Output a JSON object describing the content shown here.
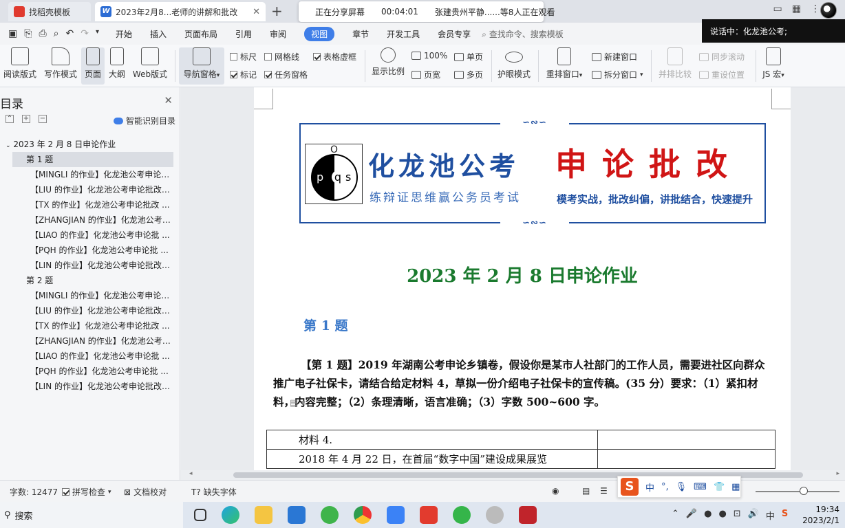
{
  "tabs": [
    {
      "label": "找稻壳模板"
    },
    {
      "label": "2023年2月8...老师的讲解和批改"
    }
  ],
  "share_bar": {
    "status": "正在分享屏幕",
    "time": "00:04:01",
    "viewers": "张建贵州平静......等8人正在观看"
  },
  "speaking": "说话中：化龙池公考;",
  "menu": {
    "items": [
      "开始",
      "插入",
      "页面布局",
      "引用",
      "审阅",
      "视图",
      "章节",
      "开发工具",
      "会员专享"
    ],
    "active": "视图",
    "search_placeholder": "查找命令、搜索模板"
  },
  "ribbon": {
    "read_mode": "阅读版式",
    "write_mode": "写作模式",
    "page": "页面",
    "outline": "大纲",
    "web": "Web版式",
    "nav_pane": "导航窗格",
    "ruler": "标尺",
    "gridlines": "网格线",
    "table_lines": "表格虚框",
    "marks": "标记",
    "task_pane": "任务窗格",
    "zoom_ratio": "显示比例",
    "zoom_100": "100%",
    "page_width": "页宽",
    "single_page": "单页",
    "multi_page": "多页",
    "eye_mode": "护眼模式",
    "rearrange": "重排窗口",
    "new_window": "新建窗口",
    "split_window": "拆分窗口",
    "side_by_side": "并排比较",
    "sync_scroll": "同步滚动",
    "reset_pos": "重设位置",
    "macro": "JS 宏"
  },
  "sidebar": {
    "title": "目录",
    "smart": "智能识别目录",
    "toc": [
      {
        "level": 1,
        "text": "2023 年 2 月 8 日申论作业"
      },
      {
        "level": 2,
        "text": "第 1 题",
        "selected": true
      },
      {
        "level": 3,
        "text": "【MINGLI 的作业】化龙池公考申论 ..."
      },
      {
        "level": 3,
        "text": "【LIU 的作业】化龙池公考申论批改 ..."
      },
      {
        "level": 3,
        "text": "【TX 的作业】化龙池公考申论批改 ..."
      },
      {
        "level": 3,
        "text": "【ZHANGJIAN 的作业】化龙池公考 ..."
      },
      {
        "level": 3,
        "text": "【LIAO 的作业】化龙池公考申论批 ..."
      },
      {
        "level": 3,
        "text": "【PQH 的作业】化龙池公考申论批 ..."
      },
      {
        "level": 3,
        "text": "【LIN 的作业】化龙池公考申论批改 ..."
      },
      {
        "level": 2,
        "text": "第 2 题"
      },
      {
        "level": 3,
        "text": "【MINGLI 的作业】化龙池公考申论 ..."
      },
      {
        "level": 3,
        "text": "【LIU 的作业】化龙池公考申论批改 ..."
      },
      {
        "level": 3,
        "text": "【TX 的作业】化龙池公考申论批改 ..."
      },
      {
        "level": 3,
        "text": "【ZHANGJIAN 的作业】化龙池公考 ..."
      },
      {
        "level": 3,
        "text": "【LIAO 的作业】化龙池公考申论批 ..."
      },
      {
        "level": 3,
        "text": "【PQH 的作业】化龙池公考申论批 ..."
      },
      {
        "level": 3,
        "text": "【LIN 的作业】化龙池公考申论批改 ..."
      }
    ]
  },
  "banner": {
    "brand": "化龙池公考",
    "title_red": "申论批改",
    "slogan": "练辩证思维赢公务员考试",
    "tagline": "模考实战，批改纠偏，讲批结合，快速提升",
    "logo_letters": [
      "O",
      "p",
      "q",
      "s"
    ]
  },
  "document": {
    "title": "2023 年 2 月 8 日申论作业",
    "question_heading": "第 1 题",
    "question_text": "【第 1 题】2019 年湖南公考申论乡镇卷，假设你是某市人社部门的工作人员，需要进社区向群众推广电子社保卡，请结合给定材料 4，草拟一份介绍电子社保卡的宣传稿。(35 分）要求：（1）紧扣材料，内容完整；（2）条理清晰，语言准确；（3）字数 500~600 字。",
    "table_rows": [
      "材料 4.",
      "2018 年 4 月 22 日，在首届“数字中国”建设成果展览"
    ]
  },
  "status": {
    "word_count": "字数: 12477",
    "spell_check": "拼写检查",
    "doc_proof": "文档校对",
    "missing_font": "缺失字体"
  },
  "ime": [
    "中",
    "°,"
  ],
  "taskbar": {
    "search": "搜索",
    "time": "19:34",
    "date": "2023/2/1"
  },
  "colors": {
    "accent": "#3f7ee8",
    "brand_blue": "#1f4fa0",
    "brand_red": "#d01515",
    "title_green": "#1a7a2e"
  }
}
